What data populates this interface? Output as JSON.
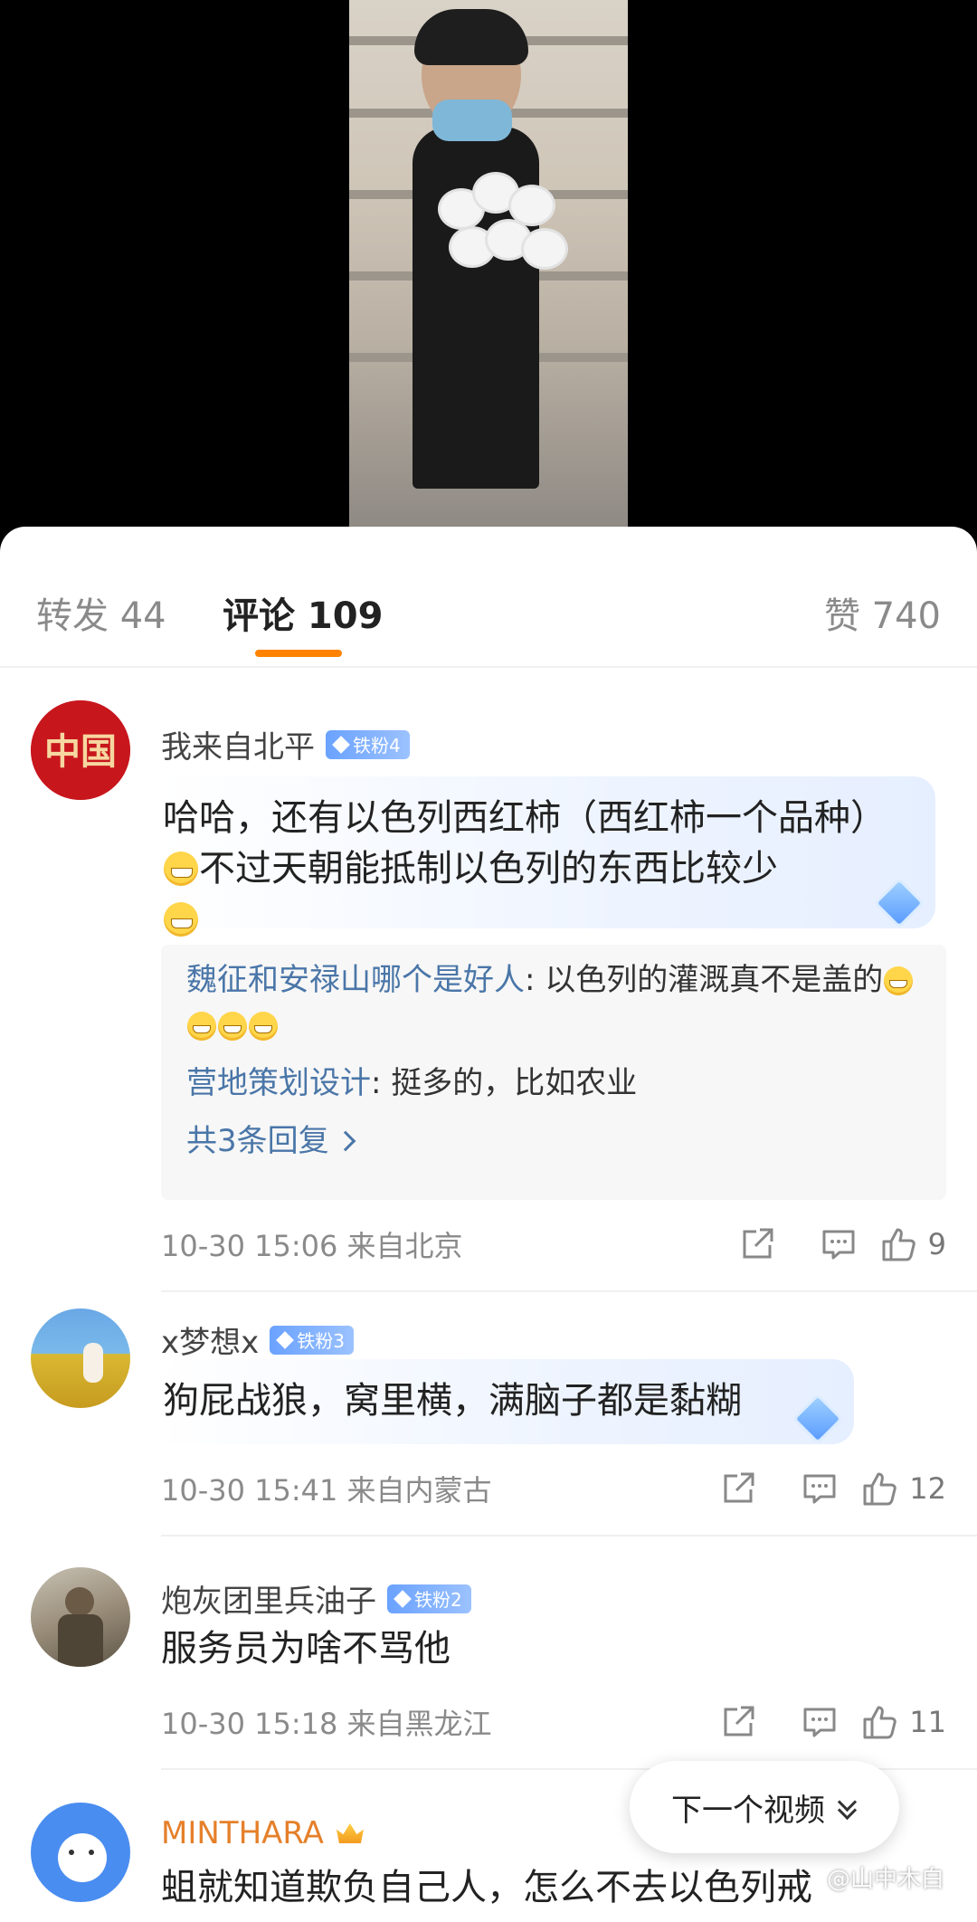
{
  "tabs": {
    "repost_label": "转发 44",
    "comment_label": "评论 109",
    "like_label": "赞 740"
  },
  "comments": [
    {
      "username": "我来自北平",
      "fan_badge": "铁粉4",
      "text_a": "哈哈，还有以色列西红柿（西红柿一个品种）",
      "text_b": "不过天朝能抵制以色列的东西比较少",
      "replies": [
        {
          "name": "魏征和安禄山哪个是好人",
          "text": ": 以色列的灌溉真不是盖的"
        },
        {
          "name": "营地策划设计",
          "text": ": 挺多的，比如农业"
        }
      ],
      "more_replies": "共3条回复",
      "meta": "10-30 15:06  来自北京",
      "likes": "9"
    },
    {
      "username": "x梦想x",
      "fan_badge": "铁粉3",
      "text": "狗屁战狼，窝里横，满脑子都是黏糊",
      "meta": "10-30 15:41  来自内蒙古",
      "likes": "12"
    },
    {
      "username": "炮灰团里兵油子",
      "fan_badge": "铁粉2",
      "text": "服务员为啥不骂他",
      "meta": "10-30 15:18  来自黑龙江",
      "likes": "11"
    },
    {
      "username": "MINTHARA",
      "text": "蛆就知道欺负自己人，怎么不去以色列戒"
    }
  ],
  "next_video_label": "下一个视频",
  "watermark": "@山中木白",
  "avatar_logo_text": "中国",
  "colors": {
    "accent": "#ff8200",
    "link": "#4a76a8",
    "badge": "#6aa2ff"
  }
}
